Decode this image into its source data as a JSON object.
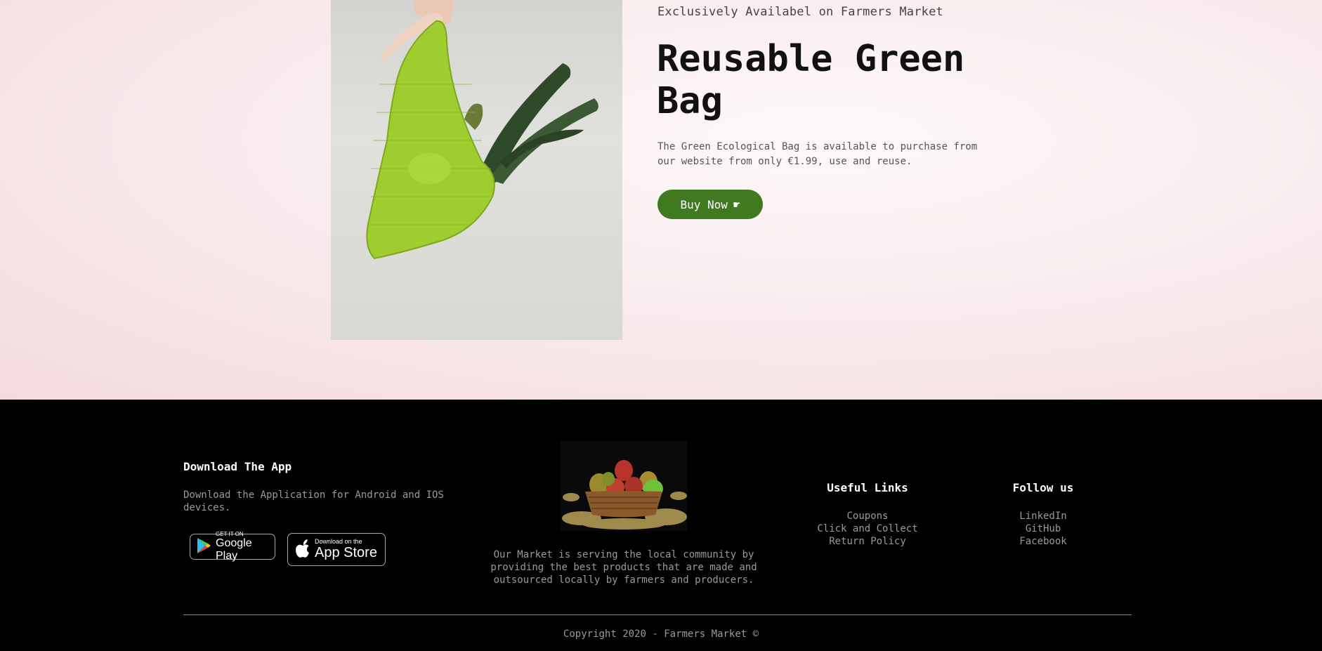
{
  "hero": {
    "kicker": "Exclusively Availabel on Farmers Market",
    "title": "Reusable Green Bag",
    "description": "The Green Ecological Bag is available to purchase from our website from only €1.99, use and reuse.",
    "button_label": "Buy Now",
    "button_icon": "☛"
  },
  "footer": {
    "app": {
      "heading": "Download The App",
      "text": "Download the Application for Android and IOS devices.",
      "google_play": {
        "small": "GET IT ON",
        "big": "Google Play"
      },
      "app_store": {
        "small": "Download on the",
        "big": "App Store"
      }
    },
    "about": {
      "text": "Our Market is serving the local community by providing the best products that are made and outsourced locally by farmers and producers."
    },
    "useful_links": {
      "heading": "Useful Links",
      "items": [
        "Coupons",
        "Click and Collect",
        "Return Policy"
      ]
    },
    "follow": {
      "heading": "Follow us",
      "items": [
        "LinkedIn",
        "GitHub",
        "Facebook"
      ]
    },
    "copyright": "Copyright 2020 - Farmers Market ©"
  },
  "colors": {
    "accent_green": "#3f7a20",
    "footer_bg": "#000000",
    "hero_bg": "#f9ecee"
  }
}
